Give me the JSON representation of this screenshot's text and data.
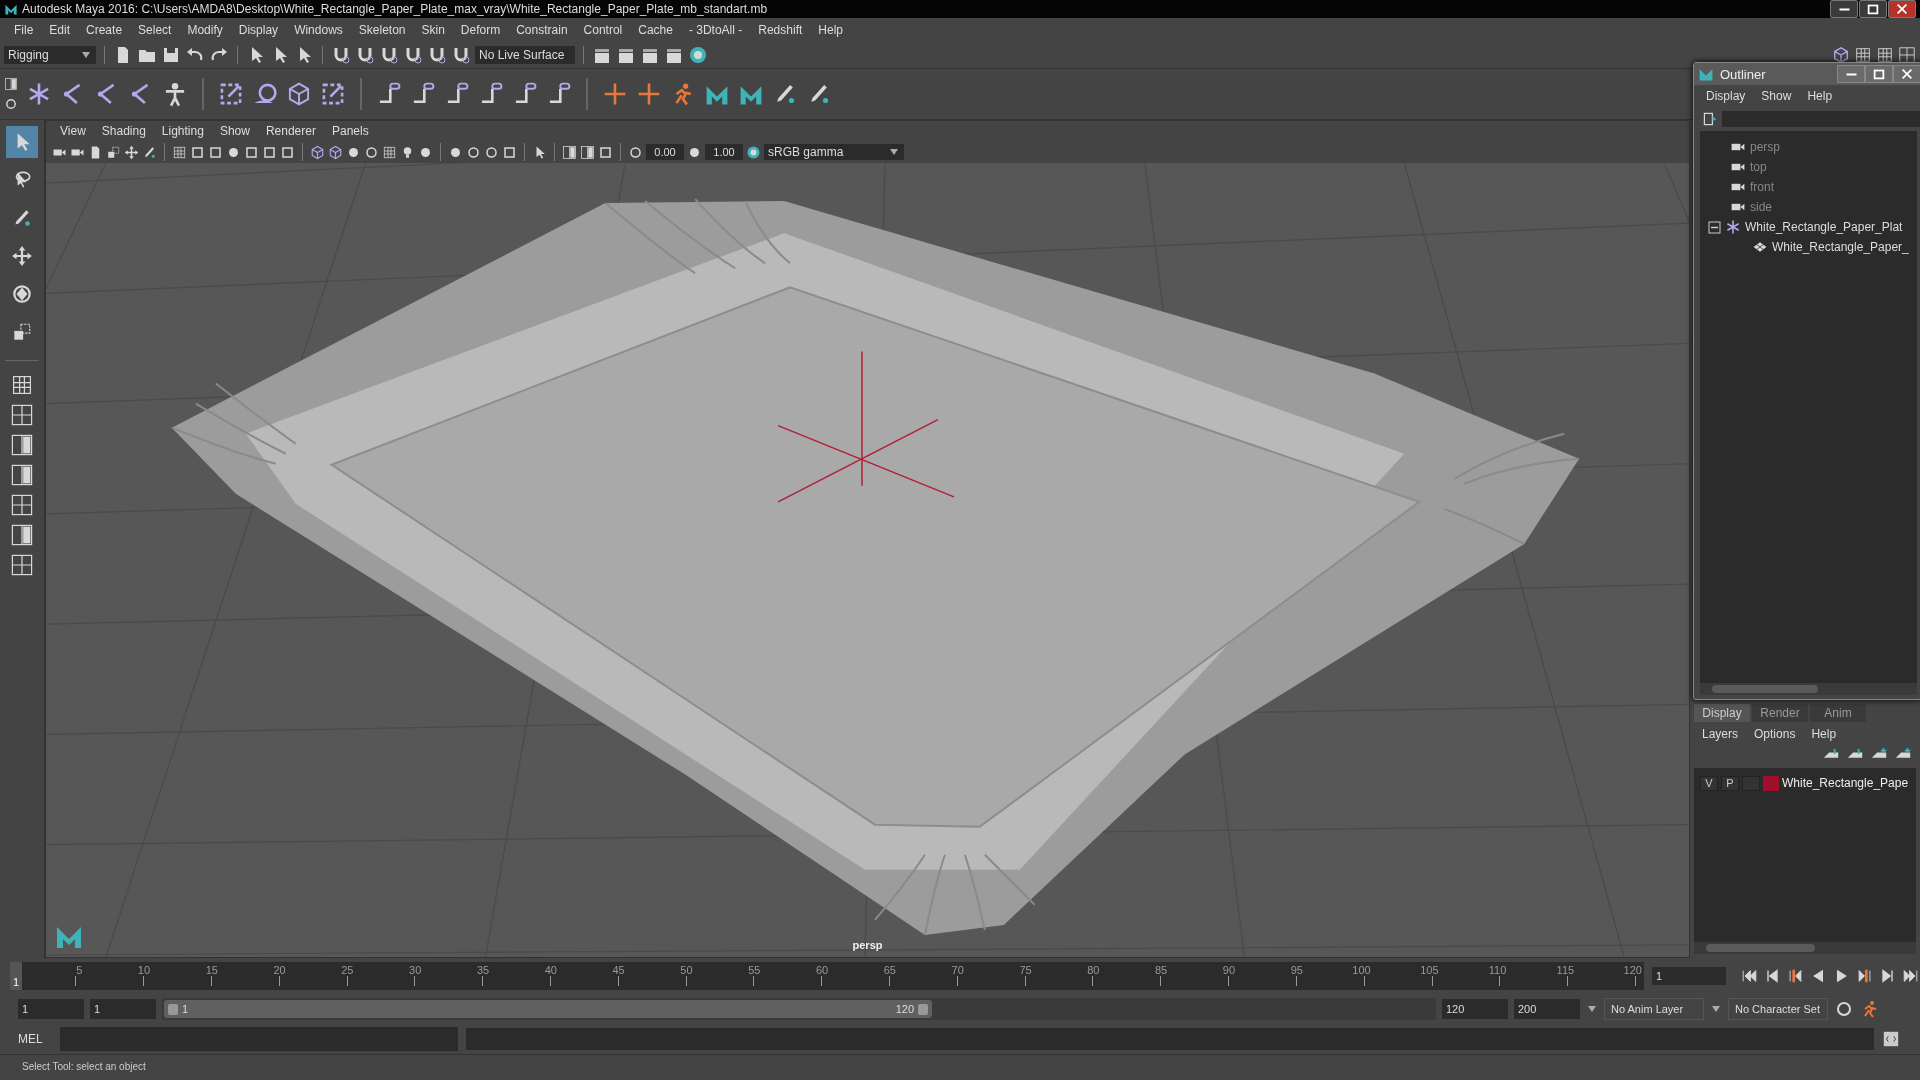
{
  "window": {
    "title": "Autodesk Maya 2016: C:\\Users\\AMDA8\\Desktop\\White_Rectangle_Paper_Plate_max_vray\\White_Rectangle_Paper_Plate_mb_standart.mb"
  },
  "menu_bar": [
    "File",
    "Edit",
    "Create",
    "Select",
    "Modify",
    "Display",
    "Windows",
    "Skeleton",
    "Skin",
    "Deform",
    "Constrain",
    "Control",
    "Cache",
    "- 3DtoAll -",
    "Redshift",
    "Help"
  ],
  "status_line": {
    "menu_set": "Rigging",
    "live_surface": "No Live Surface"
  },
  "toolbox": [
    {
      "selected": true
    },
    {
      "selected": false
    },
    {
      "selected": false
    },
    {
      "selected": false
    },
    {
      "selected": false
    },
    {
      "selected": false
    }
  ],
  "viewport": {
    "menu": [
      "View",
      "Shading",
      "Lighting",
      "Show",
      "Renderer",
      "Panels"
    ],
    "exposure": "0.00",
    "gamma": "1.00",
    "color_space": "sRGB gamma",
    "camera": "persp"
  },
  "outliner": {
    "title": "Outliner",
    "menu": [
      "Display",
      "Show",
      "Help"
    ],
    "items": [
      {
        "label": "persp",
        "kind": "camera"
      },
      {
        "label": "top",
        "kind": "camera"
      },
      {
        "label": "front",
        "kind": "camera"
      },
      {
        "label": "side",
        "kind": "camera"
      },
      {
        "label": "White_Rectangle_Paper_Plat",
        "kind": "group",
        "expanded": true,
        "children": [
          {
            "label": "White_Rectangle_Paper_",
            "kind": "mesh"
          }
        ]
      }
    ]
  },
  "layer_editor": {
    "tabs": [
      {
        "label": "Display",
        "selected": true
      },
      {
        "label": "Render",
        "selected": false
      },
      {
        "label": "Anim",
        "selected": false
      }
    ],
    "menu": [
      "Layers",
      "Options",
      "Help"
    ],
    "layers": [
      {
        "visibility": "V",
        "playback": "P",
        "color": "#9e0f2b",
        "name": "White_Rectangle_Pape"
      }
    ]
  },
  "time_slider": {
    "current_frame": "1",
    "ticks": [
      "5",
      "10",
      "15",
      "20",
      "25",
      "30",
      "35",
      "40",
      "45",
      "50",
      "55",
      "60",
      "65",
      "70",
      "75",
      "80",
      "85",
      "90",
      "95",
      "100",
      "105",
      "110",
      "115",
      "120"
    ],
    "frame_field": "1"
  },
  "range_slider": {
    "start": "1",
    "playback_start": "1",
    "range_start": "1",
    "range_end": "120",
    "playback_end": "120",
    "end": "200",
    "anim_layer": "No Anim Layer",
    "character_set": "No Character Set"
  },
  "command_line": {
    "language": "MEL"
  },
  "help_line": "Select Tool: select an object"
}
